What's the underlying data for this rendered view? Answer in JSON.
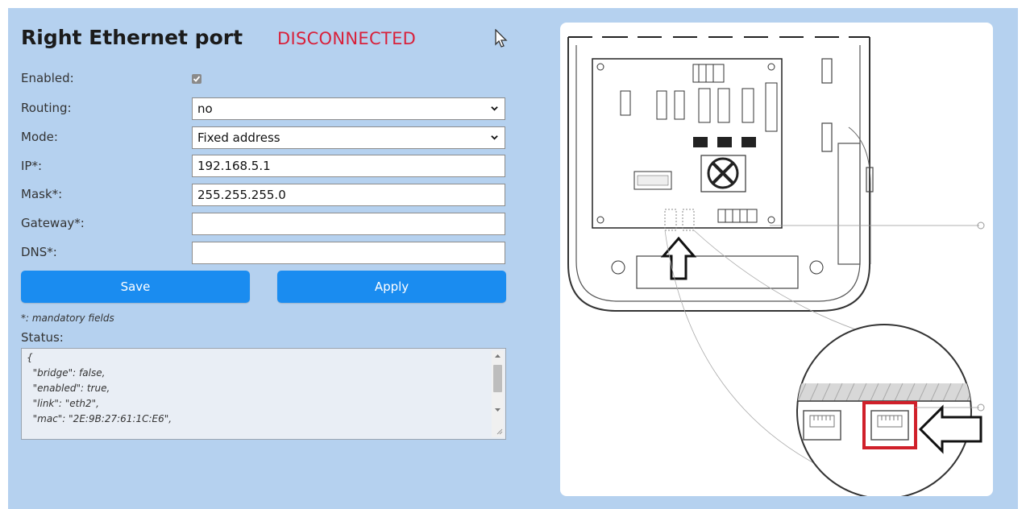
{
  "header": {
    "title": "Right Ethernet port",
    "connection_status": "DISCONNECTED"
  },
  "form": {
    "enabled": {
      "label": "Enabled:",
      "checked": true
    },
    "routing": {
      "label": "Routing:",
      "value": "no"
    },
    "mode": {
      "label": "Mode:",
      "value": "Fixed address"
    },
    "ip": {
      "label": "IP*:",
      "value": "192.168.5.1"
    },
    "mask": {
      "label": "Mask*:",
      "value": "255.255.255.0"
    },
    "gateway": {
      "label": "Gateway*:",
      "value": ""
    },
    "dns": {
      "label": "DNS*:",
      "value": ""
    }
  },
  "buttons": {
    "save": "Save",
    "apply": "Apply"
  },
  "mandatory_note": "*: mandatory fields",
  "status": {
    "label": "Status:",
    "lines": [
      "{",
      "  \"bridge\": false,",
      "  \"enabled\": true,",
      "  \"link\": \"eth2\",",
      "  \"mac\": \"2E:9B:27:61:1C:E6\","
    ]
  },
  "colors": {
    "panel_bg": "#b5d1ef",
    "button": "#1a8cf0",
    "disconnected": "#d8213b",
    "highlight_port": "#d0202a"
  },
  "icons": {
    "cursor": "mouse-pointer-icon",
    "dropdown": "chevron-down-icon",
    "port_arrow": "outline-arrow-icon"
  }
}
